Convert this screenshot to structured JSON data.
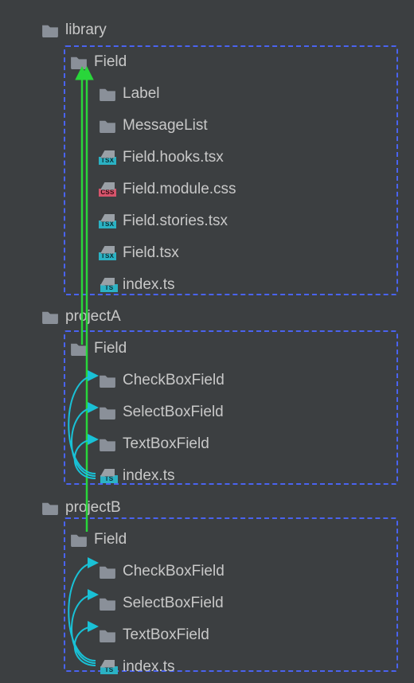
{
  "tree": {
    "library": {
      "label": "library",
      "Field": {
        "label": "Field",
        "children": [
          {
            "kind": "folder",
            "label": "Label"
          },
          {
            "kind": "folder",
            "label": "MessageList"
          },
          {
            "kind": "tsx",
            "label": "Field.hooks.tsx"
          },
          {
            "kind": "css",
            "label": "Field.module.css"
          },
          {
            "kind": "tsx",
            "label": "Field.stories.tsx"
          },
          {
            "kind": "tsx",
            "label": "Field.tsx"
          },
          {
            "kind": "ts",
            "label": "index.ts"
          }
        ]
      }
    },
    "projectA": {
      "label": "projectA",
      "Field": {
        "label": "Field",
        "children": [
          {
            "kind": "folder",
            "label": "CheckBoxField"
          },
          {
            "kind": "folder",
            "label": "SelectBoxField"
          },
          {
            "kind": "folder",
            "label": "TextBoxField"
          },
          {
            "kind": "ts",
            "label": "index.ts"
          }
        ]
      }
    },
    "projectB": {
      "label": "projectB",
      "Field": {
        "label": "Field",
        "children": [
          {
            "kind": "folder",
            "label": "CheckBoxField"
          },
          {
            "kind": "folder",
            "label": "SelectBoxField"
          },
          {
            "kind": "folder",
            "label": "TextBoxField"
          },
          {
            "kind": "ts",
            "label": "index.ts"
          }
        ]
      }
    }
  },
  "colors": {
    "green_arrow": "#29d63a",
    "cyan_arrow": "#19c1d6",
    "dashed_border": "#4a63f0"
  }
}
